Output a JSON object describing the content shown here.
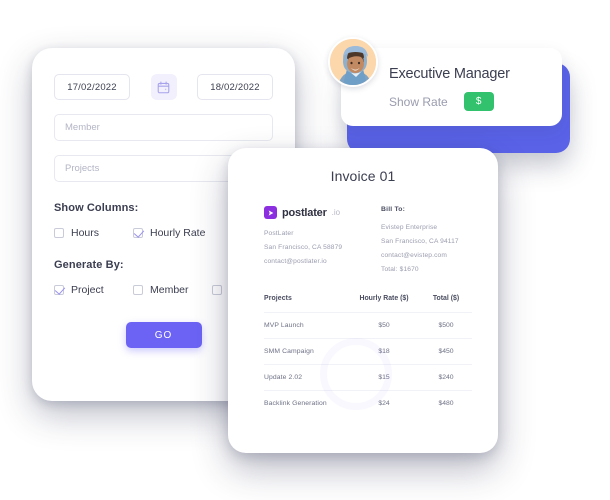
{
  "filter_card": {
    "date_from": "17/02/2022",
    "date_to": "18/02/2022",
    "calendar_icon": "calendar-icon",
    "member_placeholder": "Member",
    "projects_placeholder": "Projects",
    "show_columns_label": "Show Columns:",
    "show_columns": [
      {
        "label": "Hours",
        "checked": false
      },
      {
        "label": "Hourly Rate",
        "checked": true
      }
    ],
    "generate_by_label": "Generate By:",
    "generate_by": [
      {
        "label": "Project",
        "checked": true
      },
      {
        "label": "Member",
        "checked": false
      },
      {
        "label": "",
        "checked": false
      }
    ],
    "go_label": "GO",
    "accent_color": "#6c63f5"
  },
  "manager_card": {
    "title": "Executive Manager",
    "show_rate_label": "Show Rate",
    "rate_badge": "$",
    "badge_color": "#32c16d",
    "back_card_color": "#5a63e8",
    "avatar_name": "avatar"
  },
  "invoice": {
    "title": "Invoice 01",
    "brand": {
      "mark": "send-icon",
      "name": "postlater",
      "tld": ".io",
      "mark_color": "#8b2fe0"
    },
    "from_lines": [
      "PostLater",
      "San Francisco, CA 58879",
      "contact@postlater.io"
    ],
    "bill_to_heading": "Bill To:",
    "bill_to_lines": [
      "Evistep Enterprise",
      "San Francisco, CA 94117",
      "contact@evistep.com",
      "Total: $1670"
    ],
    "table": {
      "headers": [
        "Projects",
        "Hourly Rate ($)",
        "Total ($)"
      ],
      "rows": [
        {
          "project": "MVP Launch",
          "rate": "$50",
          "total": "$500"
        },
        {
          "project": "SMM Campaign",
          "rate": "$18",
          "total": "$450"
        },
        {
          "project": "Update 2.02",
          "rate": "$15",
          "total": "$240"
        },
        {
          "project": "Backlink Generation",
          "rate": "$24",
          "total": "$480"
        }
      ]
    }
  }
}
